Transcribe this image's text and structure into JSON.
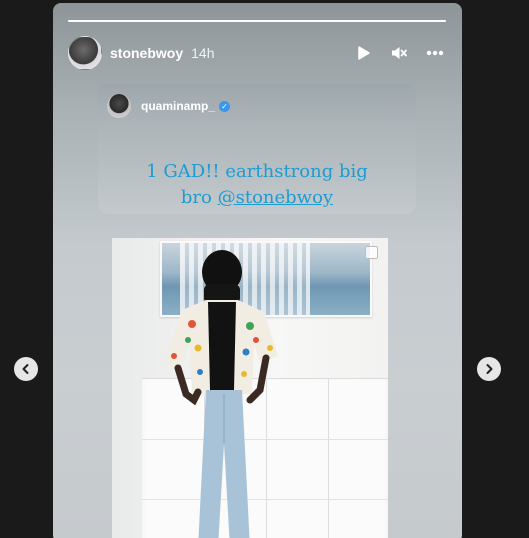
{
  "story": {
    "username": "stonebwoy",
    "time": "14h",
    "progress_fraction": 1.0
  },
  "controls": {
    "play_icon": "play-icon",
    "mute_icon": "muted-speaker-icon",
    "more_icon": "more-dots-icon"
  },
  "shared_post": {
    "username": "quaminamp_",
    "verified": true,
    "caption_line1": "1 GAD!! earthstrong big",
    "caption_line2_prefix": "bro ",
    "caption_mention": "@stonebwoy"
  },
  "navigation": {
    "prev_icon": "chevron-left-icon",
    "next_icon": "chevron-right-icon"
  },
  "colors": {
    "caption": "#1e9bd1",
    "verified_badge": "#3897f0",
    "background": "#1a1a1a"
  }
}
